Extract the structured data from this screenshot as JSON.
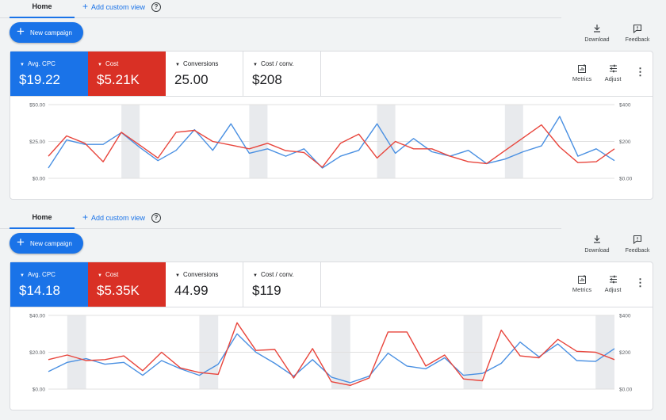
{
  "panels": [
    {
      "tabs": {
        "home": "Home",
        "add_view": "Add custom view"
      },
      "buttons": {
        "new_campaign": "New campaign",
        "download": "Download",
        "feedback": "Feedback",
        "metrics": "Metrics",
        "adjust": "Adjust"
      },
      "tiles": [
        {
          "name": "Avg. CPC",
          "value": "$19.22"
        },
        {
          "name": "Cost",
          "value": "$5.21K"
        },
        {
          "name": "Conversions",
          "value": "25.00"
        },
        {
          "name": "Cost / conv.",
          "value": "$208"
        }
      ],
      "chart_data": {
        "type": "line",
        "x": [
          1,
          2,
          3,
          4,
          5,
          6,
          7,
          8,
          9,
          10,
          11,
          12,
          13,
          14,
          15,
          16,
          17,
          18,
          19,
          20,
          21,
          22,
          23,
          24,
          25,
          26,
          27,
          28,
          29,
          30
        ],
        "left_axis": {
          "ticks": [
            "$0.00",
            "$25.00",
            "$50.00"
          ],
          "range": [
            0,
            50
          ]
        },
        "right_axis": {
          "ticks": [
            "$0.00",
            "$200",
            "$400"
          ],
          "range": [
            0,
            400
          ]
        },
        "shaded_bands": [
          [
            5,
            6
          ],
          [
            12,
            13
          ],
          [
            19,
            20
          ],
          [
            26,
            27
          ]
        ],
        "series": [
          {
            "color": "#4a90e2",
            "axis": "left",
            "values": [
              7,
              26,
              23,
              23,
              31,
              21,
              12,
              19,
              33,
              19,
              37,
              17,
              20,
              15,
              20,
              7,
              15,
              19,
              37,
              17,
              27,
              18,
              15,
              19,
              10,
              13,
              18,
              22,
              42,
              15,
              20,
              12
            ]
          },
          {
            "color": "#e8453c",
            "axis": "right",
            "values": [
              120,
              230,
              190,
              90,
              250,
              180,
              110,
              250,
              260,
              200,
              180,
              160,
              190,
              150,
              140,
              60,
              190,
              240,
              110,
              200,
              160,
              160,
              120,
              90,
              80,
              150,
              220,
              290,
              170,
              85,
              90,
              160
            ]
          }
        ]
      }
    },
    {
      "tabs": {
        "home": "Home",
        "add_view": "Add custom view"
      },
      "buttons": {
        "new_campaign": "New campaign",
        "download": "Download",
        "feedback": "Feedback",
        "metrics": "Metrics",
        "adjust": "Adjust"
      },
      "tiles": [
        {
          "name": "Avg. CPC",
          "value": "$14.18"
        },
        {
          "name": "Cost",
          "value": "$5.35K"
        },
        {
          "name": "Conversions",
          "value": "44.99"
        },
        {
          "name": "Cost / conv.",
          "value": "$119"
        }
      ],
      "chart_data": {
        "type": "line",
        "x": [
          1,
          2,
          3,
          4,
          5,
          6,
          7,
          8,
          9,
          10,
          11,
          12,
          13,
          14,
          15,
          16,
          17,
          18,
          19,
          20,
          21,
          22,
          23,
          24,
          25,
          26,
          27,
          28,
          29,
          30
        ],
        "left_axis": {
          "ticks": [
            "$0.00",
            "$20.00",
            "$40.00"
          ],
          "range": [
            0,
            40
          ]
        },
        "right_axis": {
          "ticks": [
            "$0.00",
            "$200",
            "$400"
          ],
          "range": [
            0,
            400
          ]
        },
        "shaded_bands": [
          [
            2,
            3
          ],
          [
            9,
            10
          ],
          [
            16,
            17
          ],
          [
            23,
            24
          ],
          [
            30,
            31
          ]
        ],
        "series": [
          {
            "color": "#4a90e2",
            "axis": "left",
            "values": [
              9.5,
              14.5,
              16.5,
              13.5,
              14.5,
              7.5,
              15.5,
              11,
              7.5,
              13.5,
              30,
              20,
              14,
              7,
              16,
              6.5,
              3.5,
              7,
              19.5,
              12.5,
              11,
              17,
              7.5,
              8.5,
              14,
              25.5,
              17.5,
              24.5,
              15.5,
              15,
              22
            ]
          },
          {
            "color": "#e8453c",
            "axis": "right",
            "values": [
              160,
              185,
              155,
              160,
              180,
              100,
              200,
              115,
              90,
              80,
              360,
              210,
              215,
              60,
              220,
              40,
              20,
              60,
              310,
              310,
              125,
              185,
              55,
              45,
              320,
              180,
              170,
              270,
              205,
              200,
              160
            ]
          }
        ]
      }
    }
  ],
  "icons": {
    "plus": "+",
    "help": "?",
    "download": "download-icon",
    "feedback": "feedback-icon",
    "metrics": "add-chart-icon",
    "adjust": "tune-icon",
    "more": "more-vert-icon"
  }
}
